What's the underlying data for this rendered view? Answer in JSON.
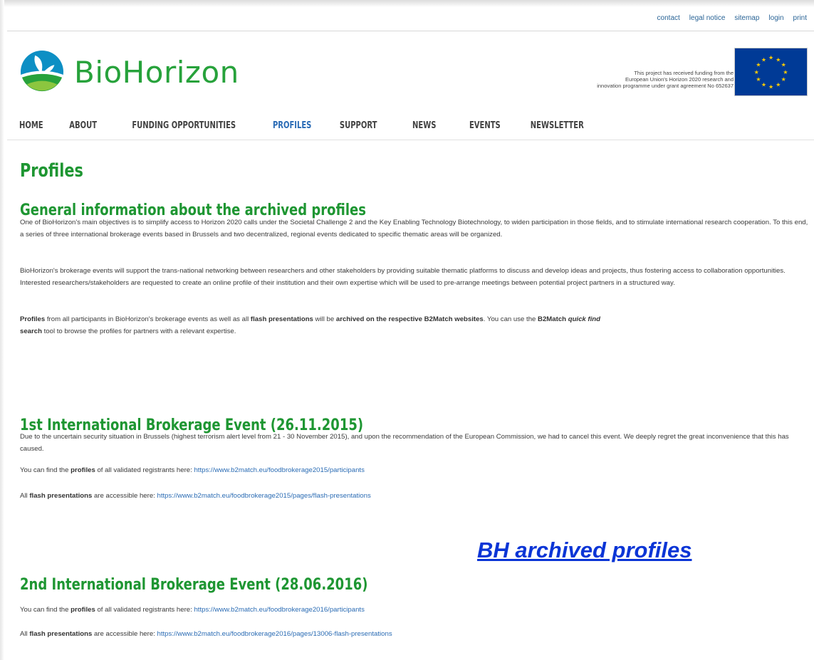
{
  "utility_nav": [
    "contact",
    "legal notice",
    "sitemap",
    "login",
    "print"
  ],
  "logo": {
    "text": "BioHorizon"
  },
  "funding_notice": {
    "line1": "This project has received funding from the",
    "line2": "European Union's Horizon 2020 research and",
    "line3": "innovation programme under grant agreement No 652637"
  },
  "main_nav": [
    "HOME",
    "ABOUT",
    "FUNDING OPPORTUNITIES",
    "PROFILES",
    "SUPPORT",
    "NEWS",
    "EVENTS",
    "NEWSLETTER"
  ],
  "active_nav": "PROFILES",
  "page_title": "Profiles",
  "general": {
    "heading": "General information about the archived profiles",
    "p1": "One of BioHorizon's main objectives is to simplify access to Horizon 2020 calls under the Societal Challenge 2 and the Key Enabling Technology Biotechnology, to widen participation in those fields, and to stimulate international research cooperation. To this end, a series of three international brokerage events based in Brussels and two decentralized, regional events dedicated to specific thematic areas will be organized.",
    "p2": "BioHorizon's brokerage events will support the trans-national networking between researchers and other stakeholders by providing suitable thematic platforms to discuss and develop ideas and projects, thus fostering access to collaboration opportunities. Interested researchers/stakeholders are requested to create an online profile of their institution and their own expertise which will be used to pre-arrange meetings between potential project partners in a structured way.",
    "p3_profiles": "Profiles",
    "p3_a": " from all participants in BioHorizon's brokerage events as well as all ",
    "p3_flash": "flash presentations",
    "p3_b": " will be ",
    "p3_archived": "archived on the respective B2Match websites",
    "p3_c": ". You can use the ",
    "p3_b2match": "B2Match",
    "p3_quick": "quick find",
    "p3_search": "search",
    "p3_tool": " tool to browse the profiles for partners with a relevant expertise."
  },
  "event1": {
    "heading": "1st International Brokerage Event (26.11.2015)",
    "p1": "Due to the uncertain security situation in Brussels (highest terrorism alert level from 21 - 30 November 2015), and upon the recommendation of the European Commission, we had to cancel this event. We deeply regret the great inconvenience that this has caused.",
    "profiles_pre": "You can find the ",
    "profiles_bold": "profiles",
    "profiles_post": " of all validated registrants here: ",
    "profiles_url": "https://www.b2match.eu/foodbrokerage2015/participants",
    "flash_pre": "All ",
    "flash_bold": "flash presentations",
    "flash_post": " are accessible here: ",
    "flash_url": "https://www.b2match.eu/foodbrokerage2015/pages/flash-presentations"
  },
  "overlay_link": "BH archived profiles",
  "event2": {
    "heading": "2nd International Brokerage Event (28.06.2016)",
    "profiles_pre": "You can find the ",
    "profiles_bold": "profiles",
    "profiles_post": " of all validated registrants here: ",
    "profiles_url": "https://www.b2match.eu/foodbrokerage2016/participants",
    "flash_pre": "All ",
    "flash_bold": "flash presentations",
    "flash_post": " are accessible here: ",
    "flash_url": "https://www.b2match.eu/foodbrokerage2016/pages/13006-flash-presentations"
  },
  "colors": {
    "brand_green": "#27a23b",
    "heading_green": "#1e9632",
    "link_blue": "#2b6cb4",
    "active_nav": "#2a6bb5",
    "overlay_blue": "#0b35d6",
    "eu_blue": "#003a96",
    "eu_star": "#ffcc00"
  }
}
